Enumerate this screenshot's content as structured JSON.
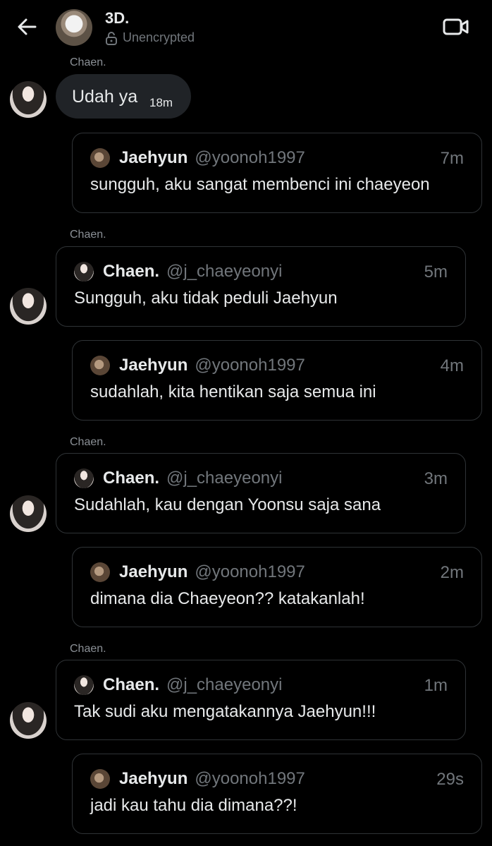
{
  "header": {
    "title": "3D.",
    "subtitle": "Unencrypted"
  },
  "messages": [
    {
      "sender": "Chaen.",
      "text": "Udah ya",
      "time": "18m"
    }
  ],
  "quotes": [
    {
      "name": "Jaehyun",
      "handle": "@yoonoh1997",
      "time": "7m",
      "text": "sungguh, aku sangat membenci ini chaeyeon"
    },
    {
      "sender": "Chaen.",
      "name": "Chaen.",
      "handle": "@j_chaeyeonyi",
      "time": "5m",
      "text": "Sungguh, aku tidak peduli Jaehyun"
    },
    {
      "name": "Jaehyun",
      "handle": "@yoonoh1997",
      "time": "4m",
      "text": "sudahlah, kita hentikan saja semua ini"
    },
    {
      "sender": "Chaen.",
      "name": "Chaen.",
      "handle": "@j_chaeyeonyi",
      "time": "3m",
      "text": "Sudahlah, kau dengan Yoonsu saja sana"
    },
    {
      "name": "Jaehyun",
      "handle": "@yoonoh1997",
      "time": "2m",
      "text": "dimana dia Chaeyeon?? katakanlah!"
    },
    {
      "sender": "Chaen.",
      "name": "Chaen.",
      "handle": "@j_chaeyeonyi",
      "time": "1m",
      "text": "Tak sudi aku mengatakannya Jaehyun!!!"
    },
    {
      "name": "Jaehyun",
      "handle": "@yoonoh1997",
      "time": "29s",
      "text": "jadi kau tahu dia dimana??!"
    }
  ],
  "icons": {
    "back": "arrow-left-icon",
    "lock": "unlocked-padlock-icon",
    "video": "video-camera-icon"
  }
}
